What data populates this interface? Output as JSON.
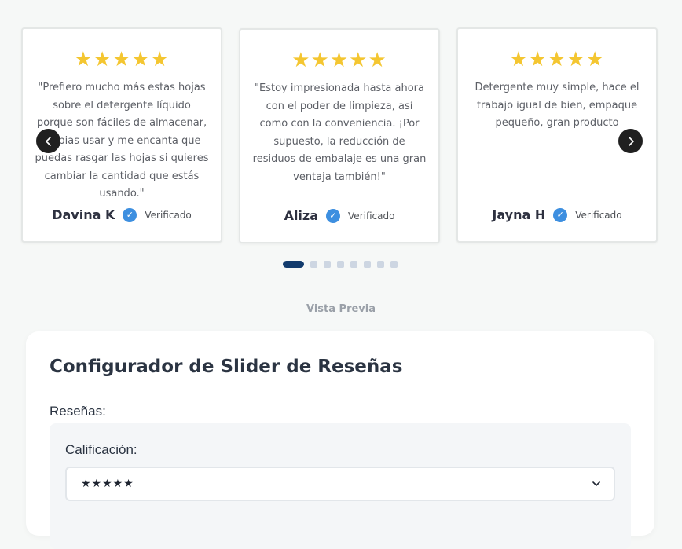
{
  "reviews": [
    {
      "stars": "★★★★★",
      "text": "\"Prefiero mucho más estas hojas sobre el detergente líquido porque son fáciles de almacenar, limpias usar y me encanta que puedas rasgar las hojas si quieres cambiar la cantidad que estás usando.\"",
      "name": "Davina K",
      "verified": "Verificado"
    },
    {
      "stars": "★★★★★",
      "text": "\"Estoy impresionada hasta ahora con el poder de limpieza, así como con la conveniencia. ¡Por supuesto, la reducción de residuos de embalaje es una gran ventaja también!\"",
      "name": "Aliza",
      "verified": "Verificado"
    },
    {
      "stars": "★★★★★",
      "text": "Detergente muy simple, hace el trabajo igual de bien, empaque pequeño, gran producto",
      "name": "Jayna H",
      "verified": "Verificado"
    }
  ],
  "slider": {
    "dot_count": 8,
    "active_dot": 1
  },
  "preview_label": "Vista Previa",
  "configurator": {
    "title": "Configurador de Slider de Reseñas",
    "reviews_label": "Reseñas:",
    "rating_label": "Calificación:",
    "rating_value": "★★★★★"
  },
  "icons": {
    "prev": "chevron-left-icon",
    "next": "chevron-right-icon",
    "verified": "check-badge-icon",
    "select": "chevron-down-icon"
  },
  "colors": {
    "star": "#f4c631",
    "verified_badge": "#3d8fe0",
    "active_dot": "#123b6d",
    "inactive_dot": "#cdd6e2",
    "arrow_bg": "#202020"
  }
}
